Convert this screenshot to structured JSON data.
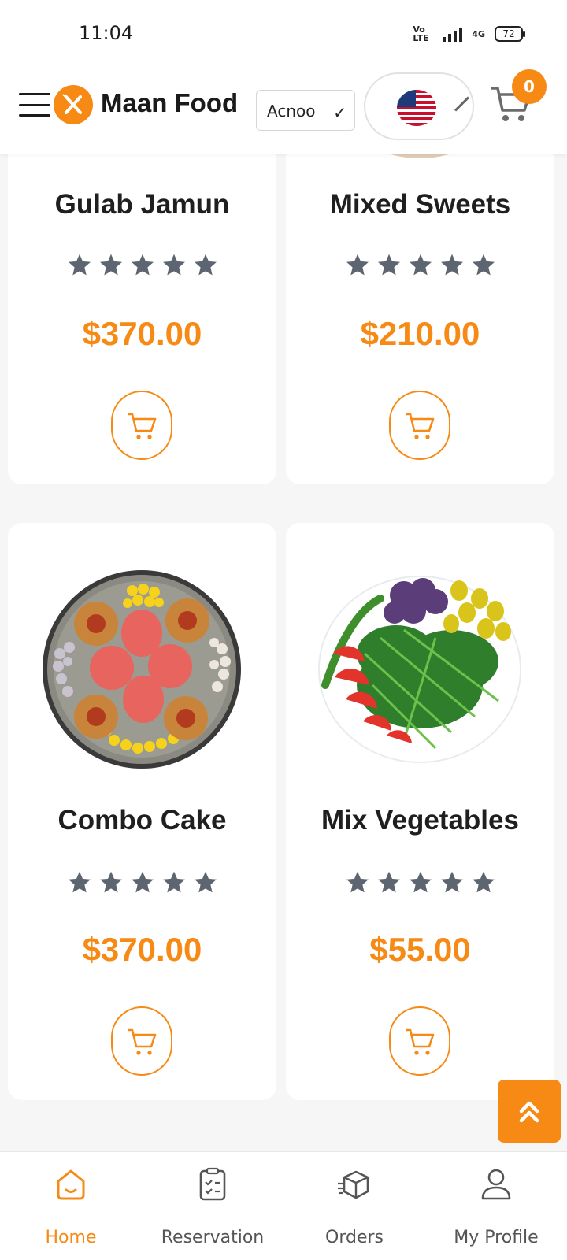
{
  "status_bar": {
    "time": "11:04",
    "volte_label": "Vo LTE",
    "network_label": "4G",
    "battery": "72"
  },
  "header": {
    "brand": "Maan Food",
    "language_value": "Acnoo",
    "cart_count": "0",
    "accent_color": "#f68a14"
  },
  "products": [
    {
      "name": "Gulab Jamun",
      "rating": 5,
      "price": "$370.00"
    },
    {
      "name": "Mixed Sweets",
      "rating": 5,
      "price": "$210.00"
    },
    {
      "name": "Combo Cake",
      "rating": 5,
      "price": "$370.00"
    },
    {
      "name": "Mix Vegetables",
      "rating": 5,
      "price": "$55.00"
    }
  ],
  "bottom_nav": [
    {
      "label": "Home",
      "icon": "home-icon",
      "active": true
    },
    {
      "label": "Reservation",
      "icon": "clipboard-icon",
      "active": false
    },
    {
      "label": "Orders",
      "icon": "box-icon",
      "active": false
    },
    {
      "label": "My Profile",
      "icon": "user-icon",
      "active": false
    }
  ]
}
